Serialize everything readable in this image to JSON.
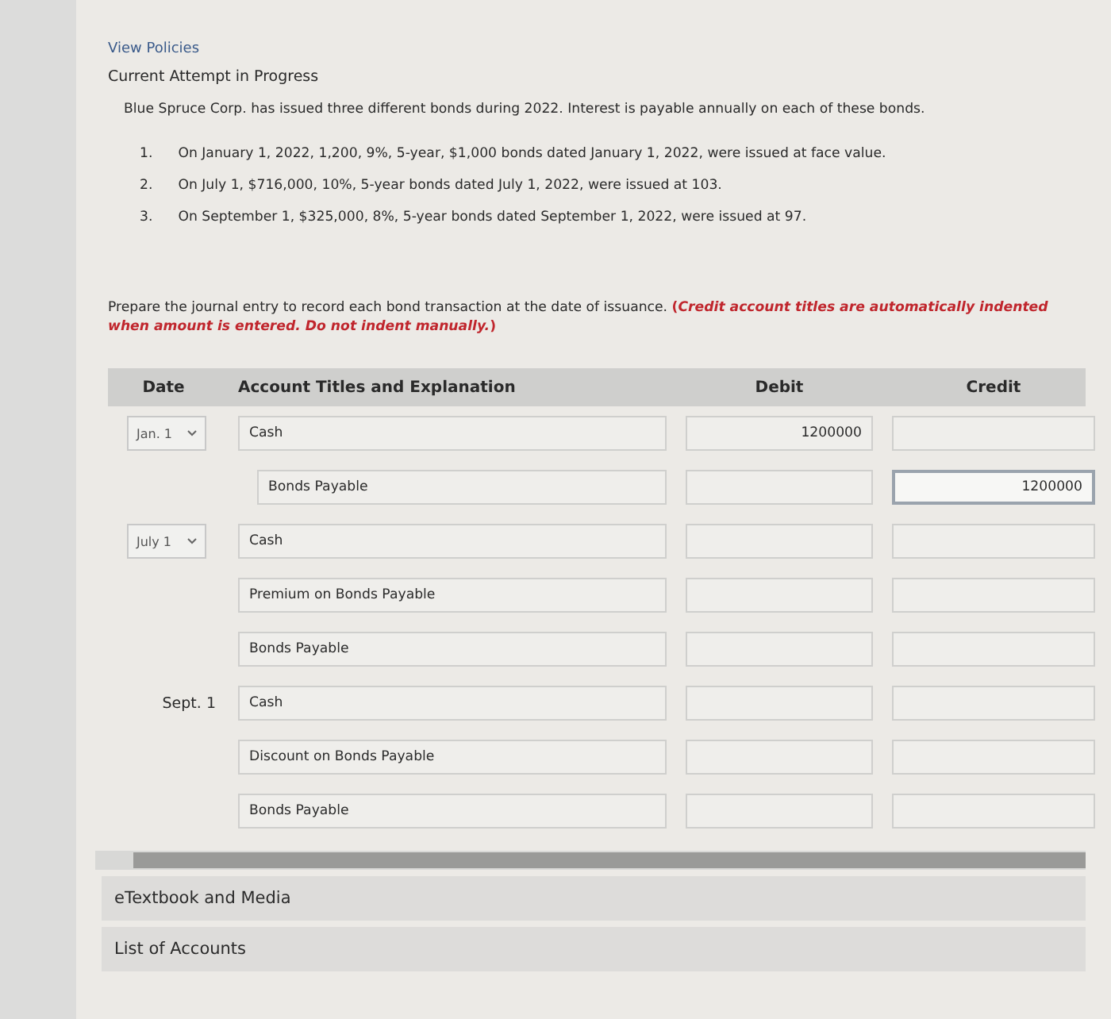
{
  "header": {
    "link": "View Policies",
    "status": "Current Attempt in Progress"
  },
  "problem": {
    "intro": "Blue Spruce Corp. has issued three different bonds during 2022. Interest is payable annually on each of these bonds.",
    "items": [
      {
        "number": "1.",
        "text": "On January 1, 2022, 1,200, 9%, 5-year, $1,000 bonds dated January 1, 2022, were issued at face value."
      },
      {
        "number": "2.",
        "text": "On July 1, $716,000, 10%, 5-year bonds dated July 1, 2022, were issued at 103."
      },
      {
        "number": "3.",
        "text": "On September 1, $325,000, 8%, 5-year bonds dated September 1, 2022, were issued at 97."
      }
    ]
  },
  "instruction": "Prepare the journal entry to record each bond transaction at the date of issuance. **(*Credit account titles are automatically indented when amount is entered. Do not indent manually.*)**",
  "table": {
    "columns": [
      "Date",
      "Account Titles and Explanation",
      "Debit",
      "Credit"
    ],
    "entries": [
      {
        "date": {
          "kind": "select",
          "text": "Jan. 1"
        },
        "lines": [
          {
            "account": "Cash",
            "indented": false,
            "debit": "1200000",
            "focused": false
          },
          {
            "account": "Bonds Payable",
            "indented": true,
            "credit": "1200000",
            "focused": true
          }
        ]
      },
      {
        "date": {
          "kind": "select",
          "text": "July 1"
        },
        "lines": [
          {
            "account": "Cash",
            "indented": false,
            "focused": false
          },
          {
            "account": "Premium on Bonds Payable",
            "indented": false,
            "focused": false
          },
          {
            "account": "Bonds Payable",
            "indented": false,
            "focused": false
          }
        ]
      },
      {
        "date": {
          "kind": "text",
          "text": "Sept. 1"
        },
        "lines": [
          {
            "account": "Cash",
            "indented": false,
            "focused": false
          },
          {
            "account": "Discount on Bonds Payable",
            "indented": false,
            "focused": false
          },
          {
            "account": "Bonds Payable",
            "indented": false,
            "focused": false
          }
        ]
      }
    ]
  },
  "sections": [
    "eTextbook and Media",
    "List of Accounts"
  ]
}
